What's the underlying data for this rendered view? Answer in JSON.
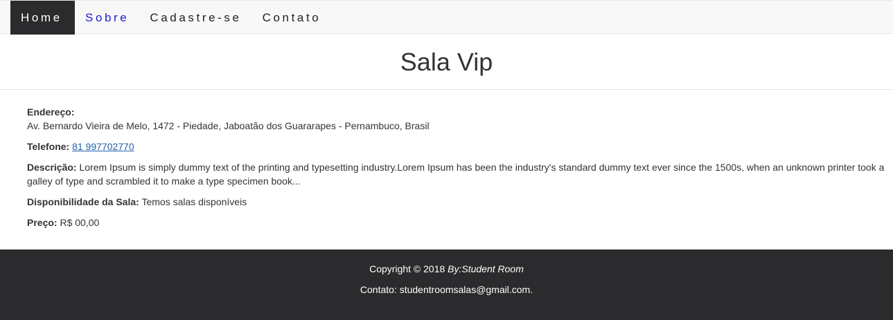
{
  "nav": {
    "items": [
      {
        "label": "Home",
        "active": true
      },
      {
        "label": "Sobre",
        "active": false
      },
      {
        "label": "Cadastre-se",
        "active": false
      },
      {
        "label": "Contato",
        "active": false
      }
    ]
  },
  "page": {
    "title": "Sala Vip"
  },
  "details": {
    "address_label": "Endereço:",
    "address_value": "Av. Bernardo Vieira de Melo, 1472 - Piedade, Jaboatão dos Guararapes - Pernambuco, Brasil",
    "phone_label": "Telefone:",
    "phone_value": "81 997702770",
    "description_label": "Descrição:",
    "description_value": "Lorem Ipsum is simply dummy text of the printing and typesetting industry.Lorem Ipsum has been the industry's standard dummy text ever since the 1500s, when an unknown printer took a galley of type and scrambled it to make a type specimen book...",
    "availability_label": "Disponibilidade da Sala:",
    "availability_value": "Temos salas disponíveis",
    "price_label": "Preço:",
    "price_value": "R$ 00,00"
  },
  "footer": {
    "copyright_text": "Copyright © 2018",
    "copyright_author": "By:Student Room",
    "contact_text": "Contato: studentroomsalas@gmail.com."
  },
  "colors": {
    "nav_active_bg": "#2b2b2e",
    "footer_bg": "#2b2b2e",
    "link": "#1e5fa8",
    "nav_sobre": "#1a1ad2"
  }
}
